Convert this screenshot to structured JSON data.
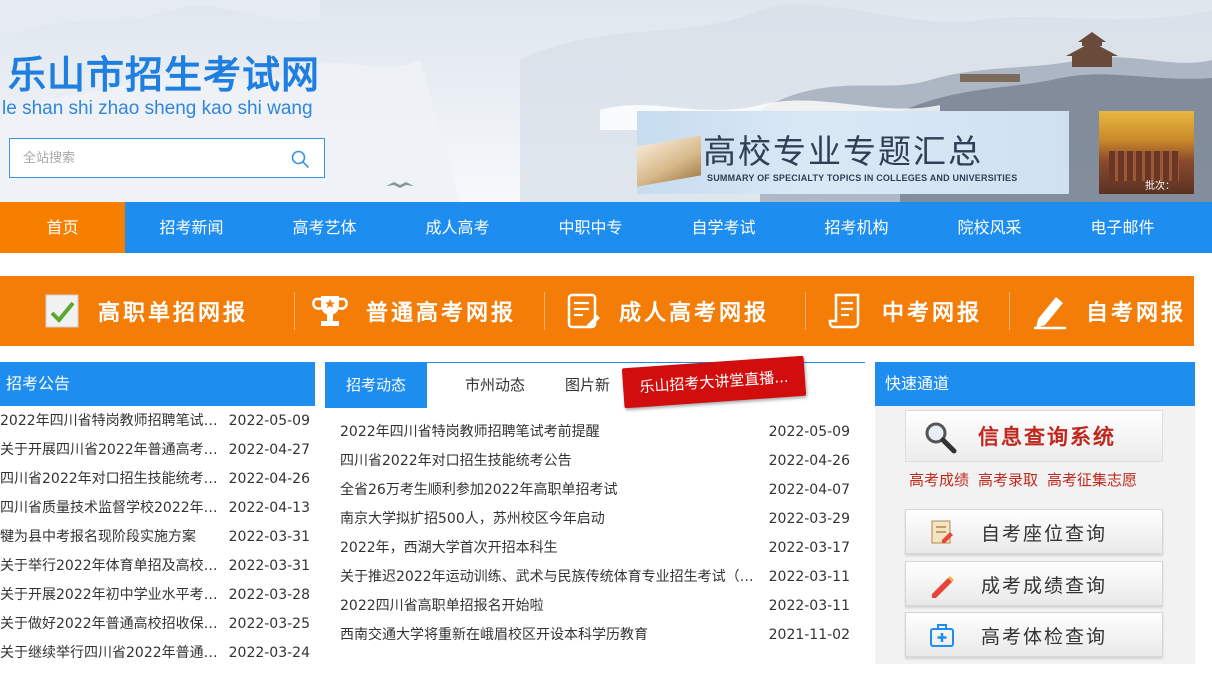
{
  "header": {
    "site_title": "乐山市招生考试网",
    "site_pinyin": "le  shan shi  zhao sheng kao shi wang",
    "search": {
      "placeholder": "全站搜索",
      "value": ""
    },
    "banner_main": {
      "title": "高校专业专题汇总",
      "subtitle": "SUMMARY OF SPECIALTY TOPICS IN COLLEGES AND UNIVERSITIES"
    },
    "banner_side": {
      "caption": "批次："
    }
  },
  "nav": {
    "items": [
      "首页",
      "招考新闻",
      "高考艺体",
      "成人高考",
      "中职中专",
      "自学考试",
      "招考机构",
      "院校风采",
      "电子邮件"
    ],
    "active_index": 0
  },
  "quickbar": {
    "items": [
      {
        "label": "高职单招网报",
        "icon": "checklist-icon"
      },
      {
        "label": "普通高考网报",
        "icon": "trophy-icon"
      },
      {
        "label": "成人高考网报",
        "icon": "document-edit-icon"
      },
      {
        "label": "中考网报",
        "icon": "scroll-document-icon"
      },
      {
        "label": "自考网报",
        "icon": "pencil-icon"
      }
    ]
  },
  "left": {
    "heading": "招考公告",
    "items": [
      {
        "title": "2022年四川省特岗教师招聘笔试考...",
        "date": "2022-05-09"
      },
      {
        "title": "关于开展四川省2022年普通高考滞...",
        "date": "2022-04-27"
      },
      {
        "title": "四川省2022年对口招生技能统考公...",
        "date": "2022-04-26"
      },
      {
        "title": "四川省质量技术监督学校2022年招...",
        "date": "2022-04-13"
      },
      {
        "title": "犍为县中考报名现阶段实施方案",
        "date": "2022-03-31"
      },
      {
        "title": "关于举行2022年体育单招及高校高...",
        "date": "2022-03-31"
      },
      {
        "title": "关于开展2022年初中学业水平考试...",
        "date": "2022-03-28"
      },
      {
        "title": "关于做好2022年普通高校招收保送...",
        "date": "2022-03-25"
      },
      {
        "title": "关于继续举行四川省2022年普通高...",
        "date": "2022-03-24"
      }
    ]
  },
  "middle": {
    "tabs": [
      "招考动态",
      "市州动态",
      "图片新"
    ],
    "live_badge": "乐山招考大讲堂直播...",
    "items": [
      {
        "title": "2022年四川省特岗教师招聘笔试考前提醒",
        "date": "2022-05-09"
      },
      {
        "title": "四川省2022年对口招生技能统考公告",
        "date": "2022-04-26"
      },
      {
        "title": "全省26万考生顺利参加2022年高职单招考试",
        "date": "2022-04-07"
      },
      {
        "title": "南京大学拟扩招500人，苏州校区今年启动",
        "date": "2022-03-29"
      },
      {
        "title": "2022年，西湖大学首次开招本科生",
        "date": "2022-03-17"
      },
      {
        "title": "关于推迟2022年运动训练、武术与民族传统体育专业招生考试（西...",
        "date": "2022-03-11"
      },
      {
        "title": "2022四川省高职单招报名开始啦",
        "date": "2022-03-11"
      },
      {
        "title": "西南交通大学将重新在峨眉校区开设本科学历教育",
        "date": "2021-11-02"
      }
    ]
  },
  "right": {
    "heading": "快速通道",
    "info_system": "信息查询系统",
    "query_links": [
      "高考成绩",
      "高考录取",
      "高考征集志愿"
    ],
    "cards": [
      {
        "label": "自考座位查询",
        "icon": "seat-form-icon"
      },
      {
        "label": "成考成绩查询",
        "icon": "pencil-score-icon"
      },
      {
        "label": "高考体检查询",
        "icon": "medical-kit-icon"
      }
    ]
  },
  "colors": {
    "primary_blue": "#1d8df0",
    "accent_orange": "#f47d08",
    "alert_red": "#d10d0d",
    "link_red": "#c0281e"
  }
}
